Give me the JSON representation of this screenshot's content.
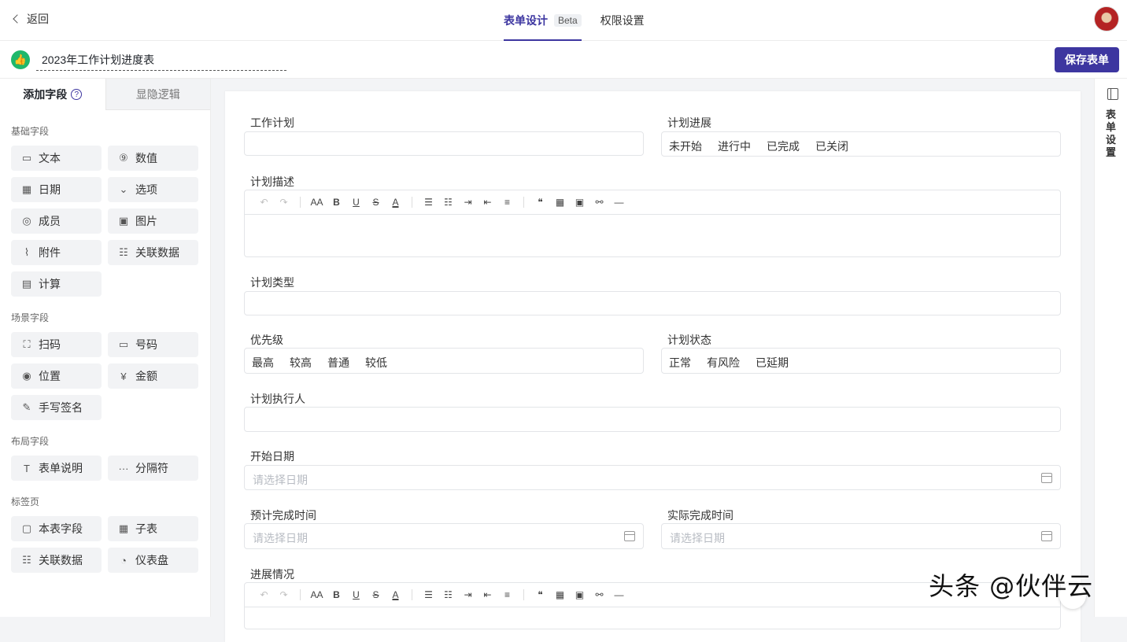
{
  "header": {
    "back_label": "返回",
    "tabs": [
      {
        "label": "表单设计",
        "badge": "Beta",
        "active": true
      },
      {
        "label": "权限设置",
        "active": false
      }
    ]
  },
  "titlebar": {
    "form_title": "2023年工作计划进度表",
    "save_label": "保存表单"
  },
  "left_panel": {
    "tabs": [
      {
        "label": "添加字段",
        "help": "?"
      },
      {
        "label": "显隐逻辑"
      }
    ],
    "sections": [
      {
        "title": "基础字段",
        "items": [
          {
            "icon": "▭",
            "label": "文本"
          },
          {
            "icon": "⑨",
            "label": "数值"
          },
          {
            "icon": "▦",
            "label": "日期"
          },
          {
            "icon": "⌄",
            "label": "选项"
          },
          {
            "icon": "◎",
            "label": "成员"
          },
          {
            "icon": "▣",
            "label": "图片"
          },
          {
            "icon": "⌇",
            "label": "附件"
          },
          {
            "icon": "☷",
            "label": "关联数据"
          },
          {
            "icon": "▤",
            "label": "计算"
          }
        ]
      },
      {
        "title": "场景字段",
        "items": [
          {
            "icon": "⛶",
            "label": "扫码"
          },
          {
            "icon": "▭",
            "label": "号码"
          },
          {
            "icon": "◉",
            "label": "位置"
          },
          {
            "icon": "¥",
            "label": "金额"
          },
          {
            "icon": "✎",
            "label": "手写签名"
          }
        ]
      },
      {
        "title": "布局字段",
        "items": [
          {
            "icon": "T",
            "label": "表单说明"
          },
          {
            "icon": "···",
            "label": "分隔符"
          }
        ]
      },
      {
        "title": "标签页",
        "items": [
          {
            "icon": "▢",
            "label": "本表字段"
          },
          {
            "icon": "▦",
            "label": "子表"
          },
          {
            "icon": "☷",
            "label": "关联数据"
          },
          {
            "icon": "◔",
            "label": "仪表盘"
          }
        ]
      }
    ]
  },
  "form": {
    "work_plan": {
      "label": "工作计划"
    },
    "plan_progress": {
      "label": "计划进展",
      "options": [
        "未开始",
        "进行中",
        "已完成",
        "已关闭"
      ]
    },
    "plan_desc": {
      "label": "计划描述"
    },
    "plan_type": {
      "label": "计划类型"
    },
    "priority": {
      "label": "优先级",
      "options": [
        "最高",
        "较高",
        "普通",
        "较低"
      ]
    },
    "plan_status": {
      "label": "计划状态",
      "options": [
        "正常",
        "有风险",
        "已延期"
      ]
    },
    "executor": {
      "label": "计划执行人"
    },
    "start_date": {
      "label": "开始日期",
      "placeholder": "请选择日期"
    },
    "expected_finish": {
      "label": "预计完成时间",
      "placeholder": "请选择日期"
    },
    "actual_finish": {
      "label": "实际完成时间",
      "placeholder": "请选择日期"
    },
    "progress": {
      "label": "进展情况"
    }
  },
  "toolbar_labels": {
    "font_size": "AA",
    "bold": "B",
    "underline": "U",
    "strike": "S",
    "color": "A"
  },
  "right_panel": {
    "label": "表单设置"
  },
  "watermark": "头条 @伙伴云"
}
